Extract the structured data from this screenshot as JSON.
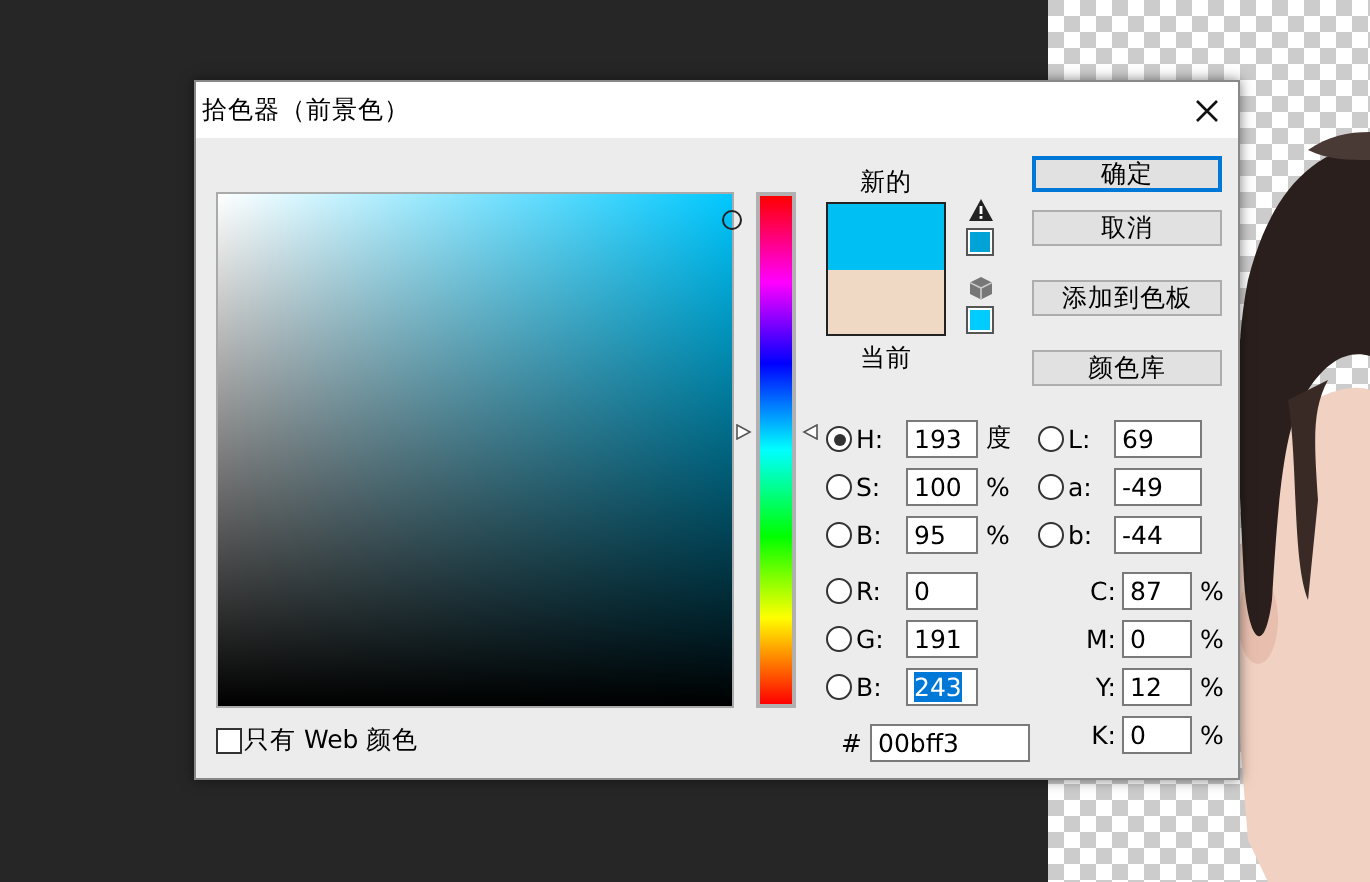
{
  "window": {
    "title": "拾色器（前景色）"
  },
  "hue_slider": {
    "level": 0.536
  },
  "preview": [
    {
      "label": "新的",
      "color": "#00bff3"
    },
    {
      "label": "当前",
      "color": "#f0d9c4"
    }
  ],
  "alerts": [
    {
      "kind": "gamut-warning",
      "color": "#00a3d6"
    },
    {
      "kind": "web-safe",
      "color": "#00ccff"
    }
  ],
  "buttons": [
    {
      "label": "确定",
      "focused": true
    },
    {
      "label": "取消",
      "focused": false
    },
    {
      "label": "添加到色板",
      "focused": false
    },
    {
      "label": "颜色库",
      "focused": false
    }
  ],
  "hsb": [
    {
      "label": "H:",
      "value": "193",
      "unit": "度",
      "selected": true
    },
    {
      "label": "S:",
      "value": "100",
      "unit": "%",
      "selected": false
    },
    {
      "label": "B:",
      "value": "95",
      "unit": "%",
      "selected": false
    }
  ],
  "lab": [
    {
      "label": "L:",
      "value": "69",
      "selected": false
    },
    {
      "label": "a:",
      "value": "-49",
      "selected": false
    },
    {
      "label": "b:",
      "value": "-44",
      "selected": false
    }
  ],
  "rgb": [
    {
      "label": "R:",
      "value": "0",
      "selected": false,
      "highlighted": false
    },
    {
      "label": "G:",
      "value": "191",
      "selected": false,
      "highlighted": false
    },
    {
      "label": "B:",
      "value": "243",
      "selected": false,
      "highlighted": true
    }
  ],
  "cmyk": [
    {
      "label": "C:",
      "value": "87",
      "unit": "%"
    },
    {
      "label": "M:",
      "value": "0",
      "unit": "%"
    },
    {
      "label": "Y:",
      "value": "12",
      "unit": "%"
    },
    {
      "label": "K:",
      "value": "0",
      "unit": "%"
    }
  ],
  "hex": {
    "label": "#",
    "value": "00bff3"
  },
  "web_only": {
    "label": "只有 Web 颜色",
    "checked": false
  }
}
